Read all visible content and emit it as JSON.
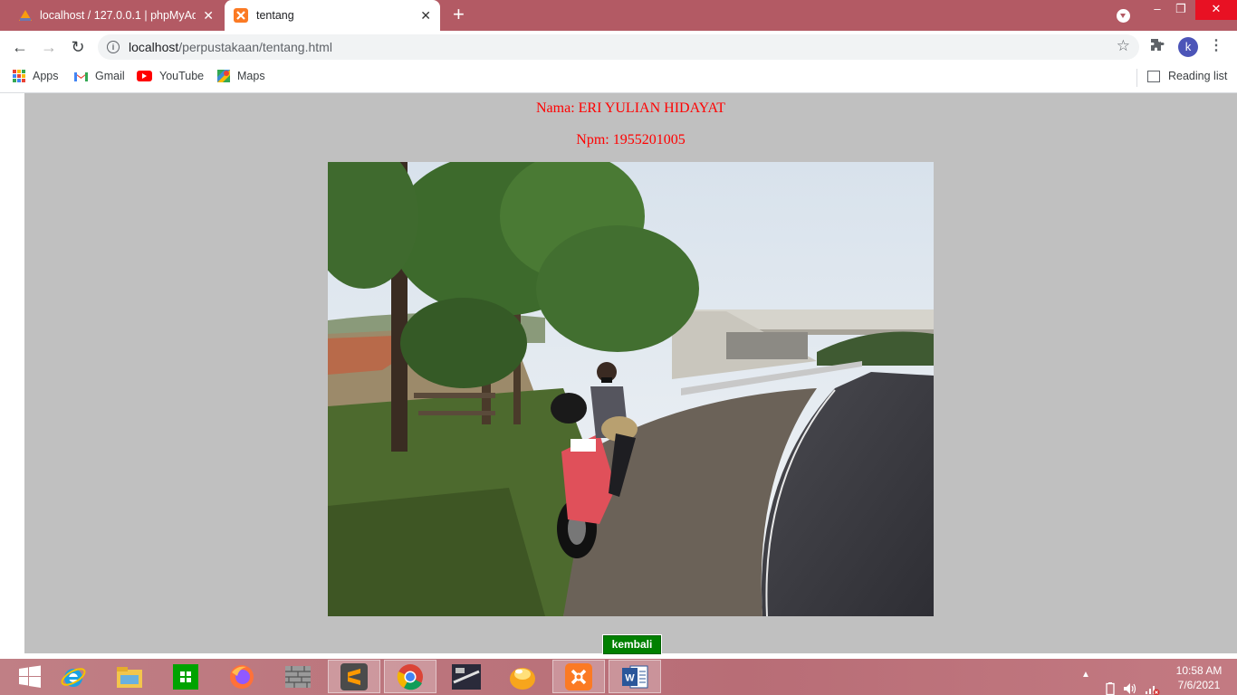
{
  "browser": {
    "tabs": [
      {
        "title": "localhost / 127.0.0.1 | phpMyAdmin",
        "active": false
      },
      {
        "title": "tentang",
        "active": true
      }
    ],
    "url": {
      "host": "localhost",
      "path": "/perpustakaan/tentang.html"
    },
    "avatar_letter": "k",
    "bookmarks": [
      {
        "label": "Apps",
        "icon": "apps-grid-icon"
      },
      {
        "label": "Gmail",
        "icon": "gmail-icon"
      },
      {
        "label": "YouTube",
        "icon": "youtube-icon"
      },
      {
        "label": "Maps",
        "icon": "maps-icon"
      }
    ],
    "reading_list_label": "Reading list"
  },
  "page": {
    "background": "#c0c0c0",
    "text_color": "#ff0000",
    "nama": "Nama: ERI YULIAN HIDAYAT",
    "npm": "Npm: 1955201005",
    "photo_icon": "photo-of-person-with-motorcycle-by-highway",
    "back_button": "kembali",
    "back_button_color": "#008000"
  },
  "taskbar": {
    "apps": [
      "start-icon",
      "internet-explorer-icon",
      "file-explorer-icon",
      "store-icon",
      "firefox-icon",
      "wall-icon",
      "sublime-text-icon",
      "chrome-icon",
      "game-icon",
      "orb-icon",
      "xampp-icon",
      "word-icon"
    ],
    "active_app": "chrome-icon",
    "clock_time": "10:58 AM",
    "clock_date": "7/6/2021"
  }
}
